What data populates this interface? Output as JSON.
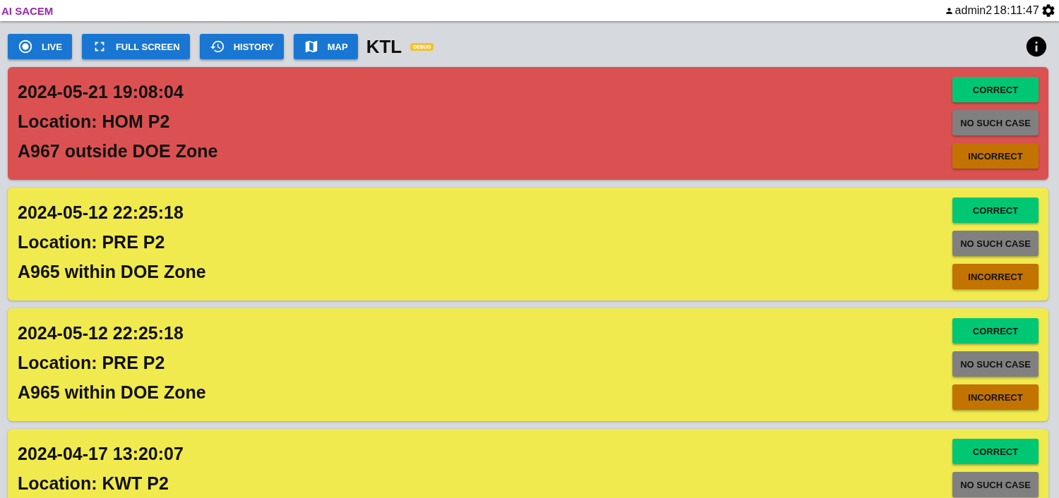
{
  "header": {
    "title": "AI SACEM",
    "user": "admin2",
    "time": "18:11:47"
  },
  "toolbar": {
    "buttons": [
      {
        "label": "LIVE",
        "kind": "live"
      },
      {
        "label": "FULL SCREEN",
        "kind": "fullscreen"
      },
      {
        "label": "HISTORY",
        "kind": "history"
      },
      {
        "label": "MAP",
        "kind": "map"
      }
    ],
    "station": "KTL",
    "badge": "DEBUG"
  },
  "alerts": [
    {
      "color": "#db5151",
      "lines": [
        "2024-05-21 19:08:04",
        "Location: HOM P2",
        "A967 outside DOE Zone"
      ],
      "actions": [
        {
          "label": "CORRECT",
          "kind": "correct"
        },
        {
          "label": "NO SUCH CASE",
          "kind": "none"
        },
        {
          "label": "INCORRECT",
          "kind": "incorrect"
        }
      ]
    },
    {
      "color": "#f0ea4e",
      "lines": [
        "2024-05-12 22:25:18",
        "Location: PRE P2",
        "A965 within DOE Zone"
      ],
      "actions": [
        {
          "label": "CORRECT",
          "kind": "correct"
        },
        {
          "label": "NO SUCH CASE",
          "kind": "none"
        },
        {
          "label": "INCORRECT",
          "kind": "incorrect"
        }
      ]
    },
    {
      "color": "#f0ea4e",
      "lines": [
        "2024-05-12 22:25:18",
        "Location: PRE P2",
        "A965 within DOE Zone"
      ],
      "actions": [
        {
          "label": "CORRECT",
          "kind": "correct"
        },
        {
          "label": "NO SUCH CASE",
          "kind": "none"
        },
        {
          "label": "INCORRECT",
          "kind": "incorrect"
        }
      ]
    },
    {
      "color": "#f0ea4e",
      "lines": [
        "2024-04-17 13:20:07",
        "Location: KWT P2"
      ],
      "actions": [
        {
          "label": "CORRECT",
          "kind": "correct"
        },
        {
          "label": "NO SUCH CASE",
          "kind": "none"
        }
      ]
    }
  ]
}
